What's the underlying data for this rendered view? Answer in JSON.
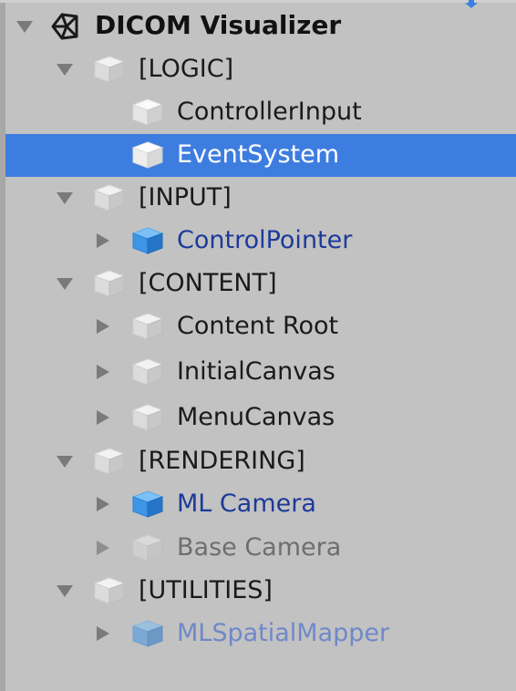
{
  "hierarchy": {
    "scene": {
      "name": "DICOM Visualizer"
    },
    "rows": [
      {
        "label": "[LOGIC]"
      },
      {
        "label": "ControllerInput"
      },
      {
        "label": "EventSystem"
      },
      {
        "label": "[INPUT]"
      },
      {
        "label": "ControlPointer"
      },
      {
        "label": "[CONTENT]"
      },
      {
        "label": "Content Root"
      },
      {
        "label": "InitialCanvas"
      },
      {
        "label": "MenuCanvas"
      },
      {
        "label": "[RENDERING]"
      },
      {
        "label": "ML Camera"
      },
      {
        "label": "Base Camera"
      },
      {
        "label": "[UTILITIES]"
      },
      {
        "label": "MLSpatialMapper"
      }
    ]
  },
  "colors": {
    "panel_background": "#c2c2c2",
    "selection": "#3e7de0",
    "prefab_text": "#1d3a9a",
    "prefab_disabled_text": "#6f88c8",
    "disabled_text": "#6e6e6e",
    "prefab_cube": "#3a8fe0"
  },
  "icons": {
    "scene": "unity-logo-icon",
    "expanded": "triangle-down-icon",
    "collapsed": "triangle-right-icon",
    "gameobject": "cube-icon",
    "prefab": "prefab-cube-icon"
  }
}
